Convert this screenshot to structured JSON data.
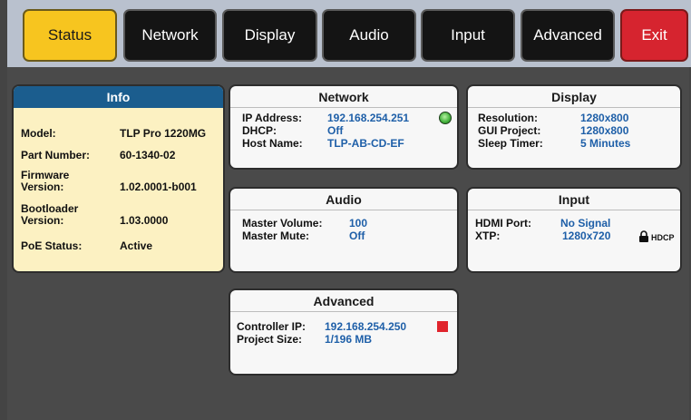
{
  "tabs": [
    {
      "label": "Status"
    },
    {
      "label": "Network"
    },
    {
      "label": "Display"
    },
    {
      "label": "Audio"
    },
    {
      "label": "Input"
    },
    {
      "label": "Advanced"
    },
    {
      "label": "Exit"
    }
  ],
  "info": {
    "title": "Info",
    "model_label": "Model:",
    "model_value": "TLP Pro 1220MG",
    "part_label": "Part Number:",
    "part_value": "60-1340-02",
    "firmware_label_1": "Firmware",
    "firmware_label_2": "Version:",
    "firmware_value": "1.02.0001-b001",
    "bootloader_label_1": "Bootloader",
    "bootloader_label_2": "Version:",
    "bootloader_value": "1.03.0000",
    "poe_label": "PoE Status:",
    "poe_value": "Active"
  },
  "network": {
    "title": "Network",
    "ip_label": "IP Address:",
    "ip_value": "192.168.254.251",
    "dhcp_label": "DHCP:",
    "dhcp_value": "Off",
    "host_label": "Host Name:",
    "host_value": "TLP-AB-CD-EF",
    "status_color": "#41b03a"
  },
  "display": {
    "title": "Display",
    "resolution_label": "Resolution:",
    "resolution_value": "1280x800",
    "gui_label": "GUI Project:",
    "gui_value": "1280x800",
    "sleep_label": "Sleep Timer:",
    "sleep_value": "5 Minutes"
  },
  "audio": {
    "title": "Audio",
    "volume_label": "Master Volume:",
    "volume_value": "100",
    "mute_label": "Master Mute:",
    "mute_value": "Off"
  },
  "input": {
    "title": "Input",
    "hdmi_label": "HDMI Port:",
    "hdmi_value": "No Signal",
    "xtp_label": "XTP:",
    "xtp_value": "1280x720",
    "hdcp_label": "HDCP"
  },
  "advanced": {
    "title": "Advanced",
    "controller_label": "Controller IP:",
    "controller_value": "192.168.254.250",
    "project_label": "Project Size:",
    "project_value": "1/196 MB",
    "status_color": "#e0242c"
  },
  "colors": {
    "active_tab": "#f7c51f",
    "exit_tab": "#d6242f",
    "value_text": "#1e5fa8",
    "info_header": "#1b5d8e"
  }
}
